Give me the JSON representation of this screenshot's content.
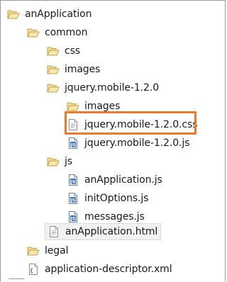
{
  "tree": {
    "items": [
      {
        "label": "anApplication",
        "icon": "open-folder-icon",
        "level": 0
      },
      {
        "label": "common",
        "icon": "open-folder-icon",
        "level": 1
      },
      {
        "label": "css",
        "icon": "open-folder-icon",
        "level": 2
      },
      {
        "label": "images",
        "icon": "open-folder-icon",
        "level": 2
      },
      {
        "label": "jquery.mobile-1.2.0",
        "icon": "open-folder-icon",
        "level": 2
      },
      {
        "label": "images",
        "icon": "open-folder-icon",
        "level": 3
      },
      {
        "label": "jquery.mobile-1.2.0.css",
        "icon": "css-file-icon",
        "level": 3,
        "highlighted": true
      },
      {
        "label": "jquery.mobile-1.2.0.js",
        "icon": "js-file-icon",
        "level": 3
      },
      {
        "label": "js",
        "icon": "open-folder-icon",
        "level": 2
      },
      {
        "label": "anApplication.js",
        "icon": "js-file-icon",
        "level": 3
      },
      {
        "label": "initOptions.js",
        "icon": "js-file-icon",
        "level": 3
      },
      {
        "label": "messages.js",
        "icon": "js-file-icon",
        "level": 3
      },
      {
        "label": "anApplication.html",
        "icon": "html-file-icon",
        "level": 2,
        "selected": true
      },
      {
        "label": "legal",
        "icon": "open-folder-icon",
        "level": 1
      },
      {
        "label": "application-descriptor.xml",
        "icon": "xml-file-icon",
        "level": 1
      }
    ]
  },
  "colors": {
    "highlight_border": "#ec7a2b",
    "folder_fill": "#f3df9d",
    "folder_stroke": "#c2a24a",
    "js_blue": "#3a6fc4"
  }
}
